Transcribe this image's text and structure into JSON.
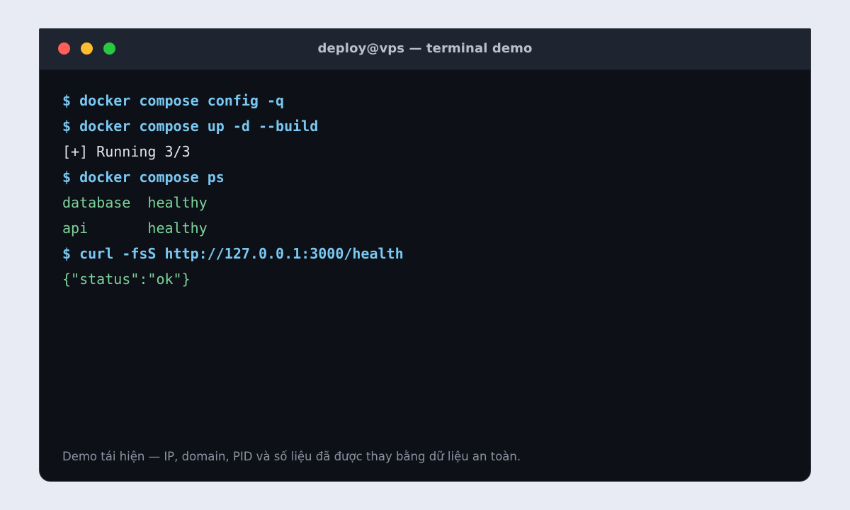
{
  "window": {
    "title": "deploy@vps — terminal demo",
    "buttons": [
      {
        "name": "close",
        "color": "#ff5f57"
      },
      {
        "name": "minimize",
        "color": "#febc2e"
      },
      {
        "name": "maximize",
        "color": "#28c840"
      }
    ]
  },
  "terminal": {
    "lines": [
      {
        "type": "command",
        "text": "$ docker compose config -q"
      },
      {
        "type": "command",
        "text": "$ docker compose up -d --build"
      },
      {
        "type": "output",
        "text": "[+] Running 3/3"
      },
      {
        "type": "command",
        "text": "$ docker compose ps"
      },
      {
        "type": "success",
        "text": "database  healthy"
      },
      {
        "type": "success",
        "text": "api       healthy"
      },
      {
        "type": "command",
        "text": "$ curl -fsS http://127.0.0.1:3000/health"
      },
      {
        "type": "success",
        "text": "{\"status\":\"ok\"}"
      }
    ]
  },
  "footer": {
    "note": "Demo tái hiện — IP, domain, PID và số liệu đã được thay bằng dữ liệu an toàn."
  },
  "colors": {
    "command": "#79c8f2",
    "output": "#e3e6ea",
    "success": "#7ed39a",
    "background": "#0d1017",
    "titlebar": "#1f2530"
  }
}
